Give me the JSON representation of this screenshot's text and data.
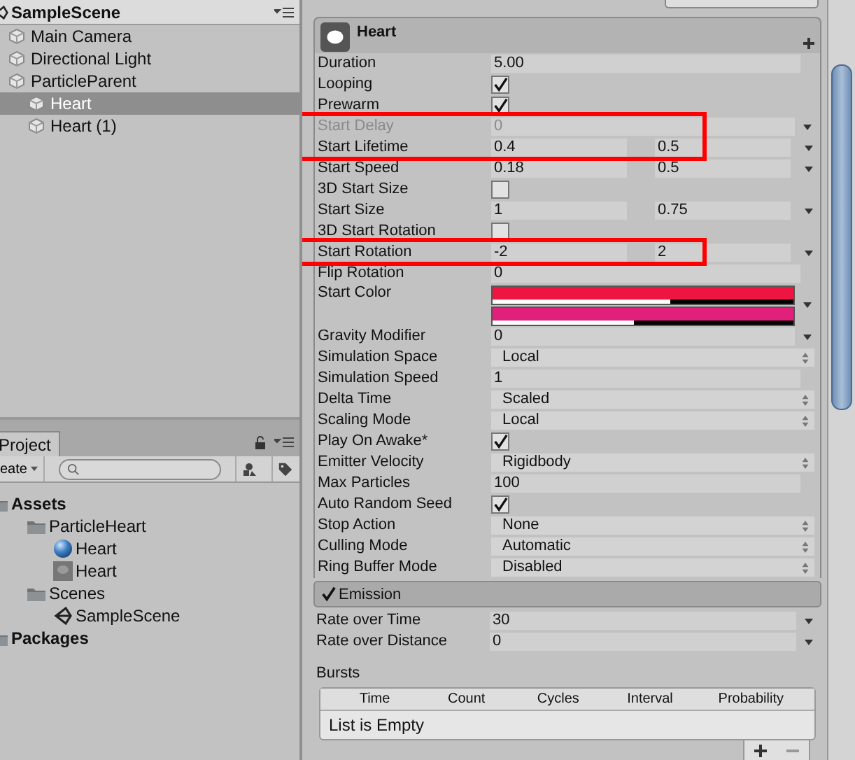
{
  "hierarchy": {
    "title": "SampleScene",
    "items": [
      {
        "label": "Main Camera",
        "selected": false
      },
      {
        "label": "Directional Light",
        "selected": false
      },
      {
        "label": "ParticleParent",
        "selected": false,
        "children": [
          {
            "label": "Heart",
            "selected": true
          },
          {
            "label": "Heart (1)",
            "selected": false
          }
        ]
      }
    ]
  },
  "project": {
    "tab": {
      "label": "Project",
      "selected": true
    },
    "create_button": "eate",
    "tree": [
      {
        "label": "Assets",
        "kind": "root",
        "children": [
          {
            "label": "ParticleHeart",
            "kind": "folder",
            "children": [
              {
                "label": "Heart",
                "kind": "material"
              },
              {
                "label": "Heart",
                "kind": "texture"
              }
            ]
          },
          {
            "label": "Scenes",
            "kind": "folder",
            "children": [
              {
                "label": "SampleScene",
                "kind": "scene"
              }
            ]
          }
        ]
      },
      {
        "label": "Packages",
        "kind": "root"
      }
    ]
  },
  "inspector": {
    "component": {
      "title": "Heart"
    },
    "rows": [
      {
        "label": "Duration",
        "kind": "field",
        "value": "5.00",
        "menu": false,
        "disabled": false
      },
      {
        "label": "Looping",
        "kind": "checkbox",
        "checked": true,
        "disabled": false
      },
      {
        "label": "Prewarm",
        "kind": "checkbox",
        "checked": true,
        "disabled": false
      },
      {
        "label": "Start Delay",
        "kind": "field",
        "value": "0",
        "menu": true,
        "disabled": true,
        "outlined": true
      },
      {
        "label": "Start Lifetime",
        "kind": "range",
        "values": [
          "0.4",
          "0.5"
        ],
        "disabled": false,
        "outlined": true
      },
      {
        "label": "Start Speed",
        "kind": "range",
        "values": [
          "0.18",
          "0.5"
        ],
        "disabled": false
      },
      {
        "label": "3D Start Size",
        "kind": "checkbox",
        "checked": false,
        "disabled": false
      },
      {
        "label": "Start Size",
        "kind": "range",
        "values": [
          "1",
          "0.75"
        ],
        "disabled": false
      },
      {
        "label": "3D Start Rotation",
        "kind": "checkbox",
        "checked": false,
        "disabled": false
      },
      {
        "label": "Start Rotation",
        "kind": "range",
        "values": [
          "-2",
          "2"
        ],
        "disabled": false,
        "outlined": true
      },
      {
        "label": "Flip Rotation",
        "kind": "field",
        "value": "0",
        "menu": false,
        "disabled": false
      },
      {
        "label": "Start Color",
        "kind": "gradient",
        "bars": [
          {
            "color": "#ee1540",
            "level": 0.59
          },
          {
            "color": "#e0207a",
            "level": 0.47
          }
        ],
        "disabled": false
      },
      {
        "label": "Gravity Modifier",
        "kind": "field",
        "value": "0",
        "menu": true,
        "disabled": false
      },
      {
        "label": "Simulation Space",
        "kind": "select",
        "value": "Local",
        "disabled": false
      },
      {
        "label": "Simulation Speed",
        "kind": "field",
        "value": "1",
        "menu": false,
        "disabled": false
      },
      {
        "label": "Delta Time",
        "kind": "select",
        "value": "Scaled",
        "disabled": false
      },
      {
        "label": "Scaling Mode",
        "kind": "select",
        "value": "Local",
        "disabled": false
      },
      {
        "label": "Play On Awake*",
        "kind": "checkbox",
        "checked": true,
        "disabled": false
      },
      {
        "label": "Emitter Velocity",
        "kind": "select",
        "value": "Rigidbody",
        "disabled": false
      },
      {
        "label": "Max Particles",
        "kind": "field",
        "value": "100",
        "menu": false,
        "disabled": false
      },
      {
        "label": "Auto Random Seed",
        "kind": "checkbox",
        "checked": true,
        "disabled": false
      },
      {
        "label": "Stop Action",
        "kind": "select",
        "value": "None",
        "disabled": false
      },
      {
        "label": "Culling Mode",
        "kind": "select",
        "value": "Automatic",
        "disabled": false
      },
      {
        "label": "Ring Buffer Mode",
        "kind": "select",
        "value": "Disabled",
        "disabled": false
      }
    ],
    "emission": {
      "title": "Emission",
      "enabled": true,
      "rows": [
        {
          "label": "Rate over Time",
          "kind": "field",
          "value": "30",
          "menu": true,
          "disabled": false
        },
        {
          "label": "Rate over Distance",
          "kind": "field",
          "value": "0",
          "menu": true,
          "disabled": false
        }
      ]
    },
    "bursts": {
      "label": "Bursts",
      "columns": [
        "Time",
        "Count",
        "Cycles",
        "Interval",
        "Probability"
      ],
      "empty_text": "List is Empty"
    }
  }
}
